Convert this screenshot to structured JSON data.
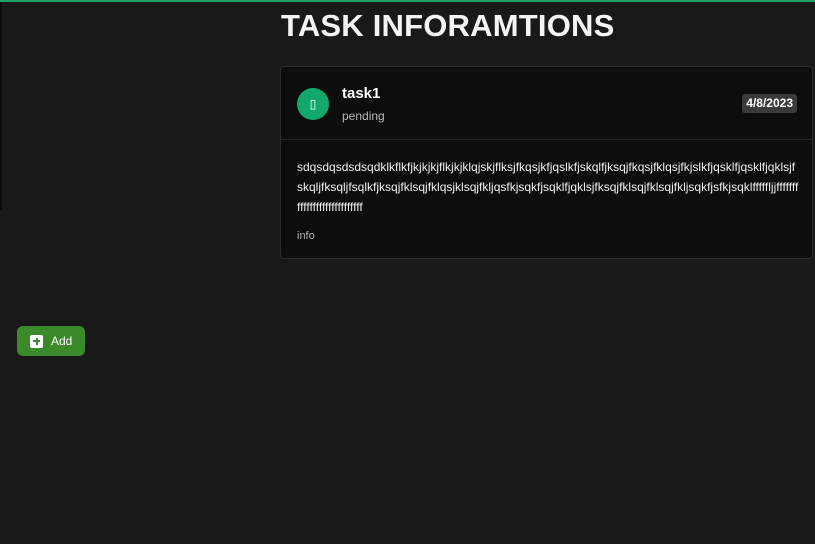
{
  "page": {
    "title": "TASK INFORAMTIONS"
  },
  "task": {
    "avatar_glyph": "▯",
    "name": "task1",
    "status": "pending",
    "date": "4/8/2023",
    "description": "sdqsdqsdsdsqdklkflkfjkjkjkjflkjkjklqjskjflksjfkqsjkfjqslkfjskqlfjksqjfkqsjfklqsjfkjslkfjqsklfjqsklfjqklsjfskqljfksqljfsqlkfjksqjfklsqjfklqsjklsqjfkljqsfkjsqkfjsqklfjqklsjfksqjfklsqjfklsqjfkljsqkfjsfkjsqklfffffljjffffffffffffffffffffffffffff",
    "info_label": "info"
  },
  "actions": {
    "add_label": "Add"
  },
  "colors": {
    "accent": "#1fa469",
    "avatar": "#13a86b",
    "add_button": "#3a8a2c",
    "background": "#1a191a",
    "card": "#0e0d0e"
  }
}
